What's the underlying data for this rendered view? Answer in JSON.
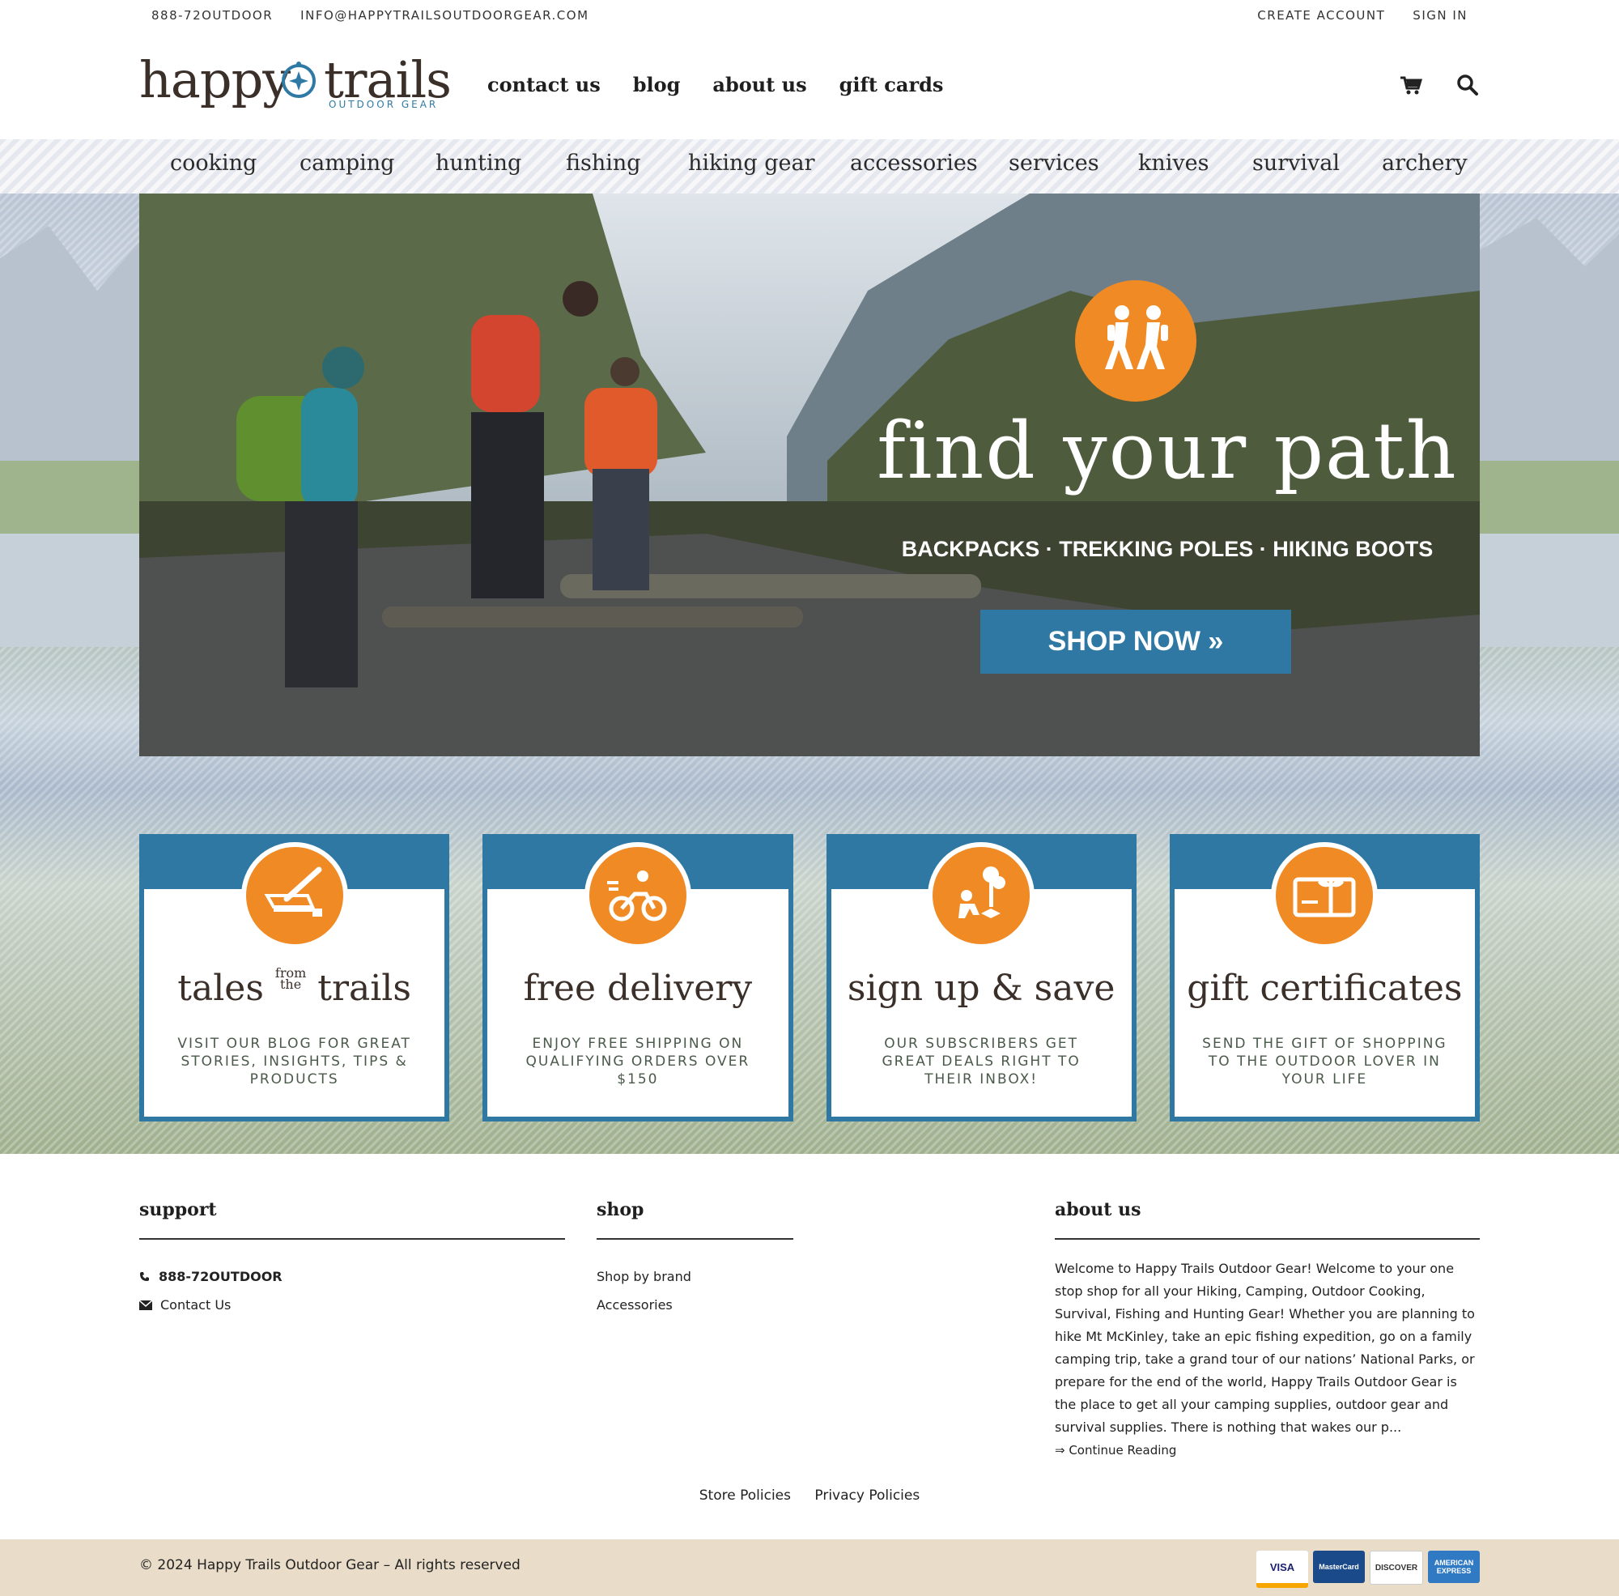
{
  "topbar": {
    "phone": "888-72OUTDOOR",
    "email": "INFO@HAPPYTRAILSOUTDOORGEAR.COM",
    "create_account": "CREATE ACCOUNT",
    "sign_in": "SIGN IN"
  },
  "logo": {
    "word1": "happy",
    "word2": "trails",
    "tagline": "OUTDOOR GEAR"
  },
  "main_nav": [
    "contact us",
    "blog",
    "about us",
    "gift cards"
  ],
  "header_icons": [
    "cart-icon",
    "search-icon"
  ],
  "categories": [
    "cooking",
    "camping",
    "hunting",
    "fishing",
    "hiking gear",
    "accessories",
    "services",
    "knives",
    "survival",
    "archery"
  ],
  "hero": {
    "headline": "find your path",
    "subline": "BACKPACKS · TREKKING POLES · HIKING BOOTS",
    "cta": "SHOP NOW »",
    "badge_icon": "hikers-icon"
  },
  "cards": [
    {
      "title_a": "tales",
      "title_small_1": "from",
      "title_small_2": "the",
      "title_b": "trails",
      "desc": "VISIT OUR BLOG FOR GREAT STORIES, INSIGHTS, TIPS & PRODUCTS",
      "icon": "journal-icon"
    },
    {
      "title": "free delivery",
      "desc": "ENJOY FREE SHIPPING ON QUALIFYING ORDERS OVER $150",
      "icon": "bicycle-icon"
    },
    {
      "title": "sign up & save",
      "desc": "OUR SUBSCRIBERS GET GREAT DEALS RIGHT TO THEIR INBOX!",
      "icon": "planting-icon"
    },
    {
      "title": "gift certificates",
      "desc": "SEND THE GIFT OF SHOPPING TO THE OUTDOOR LOVER IN YOUR LIFE",
      "icon": "gift-card-icon"
    }
  ],
  "footer": {
    "support": {
      "heading": "support",
      "phone": "888-72OUTDOOR",
      "contact": "Contact Us"
    },
    "shop": {
      "heading": "shop",
      "items": [
        "Shop by brand",
        "Accessories"
      ]
    },
    "about": {
      "heading": "about us",
      "text": "Welcome to Happy Trails Outdoor Gear! Welcome to your one stop shop for all your Hiking, Camping, Outdoor Cooking, Survival, Fishing and Hunting Gear! Whether you are planning to hike Mt McKinley, take an epic fishing expedition, go on a family camping trip, take a grand tour of our nations’ National Parks, or prepare for the end of the world, Happy Trails Outdoor Gear is the place to get all your camping supplies, outdoor gear and survival supplies. There is nothing that wakes our p...",
      "continue": "⇒ Continue Reading"
    },
    "policies": [
      "Store Policies",
      "Privacy Policies"
    ],
    "copyright": "© 2024 Happy Trails Outdoor Gear – All rights reserved",
    "payment": [
      "VISA",
      "MasterCard",
      "DISCOVER",
      "AMERICAN EXPRESS"
    ]
  },
  "colors": {
    "accent_orange": "#f08a24",
    "accent_blue": "#2f78a3",
    "footer_bar": "#e9ddc9"
  }
}
